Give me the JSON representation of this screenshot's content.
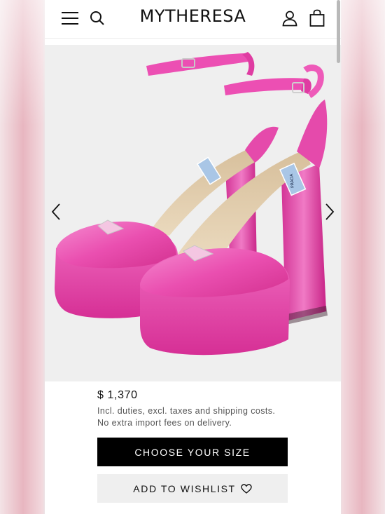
{
  "header": {
    "logo": "MYTHERESA",
    "icons": [
      "menu-icon",
      "search-icon",
      "account-icon",
      "shopping-bag-icon"
    ]
  },
  "gallery": {
    "product_image": "pink-satin-platform-sandals",
    "insole_brand": "PRADA",
    "icons": [
      "chevron-left-icon",
      "chevron-right-icon"
    ]
  },
  "product": {
    "price": "$ 1,370",
    "tax_note": "Incl. duties, excl. taxes and shipping costs.",
    "import_note": "No extra import fees on delivery.",
    "size_button": "CHOOSE YOUR SIZE",
    "wishlist_button": "ADD TO WISHLIST"
  },
  "colors": {
    "shoe_pink": "#e83fa8",
    "button_black": "#000000",
    "wishlist_bg": "#efefef"
  }
}
